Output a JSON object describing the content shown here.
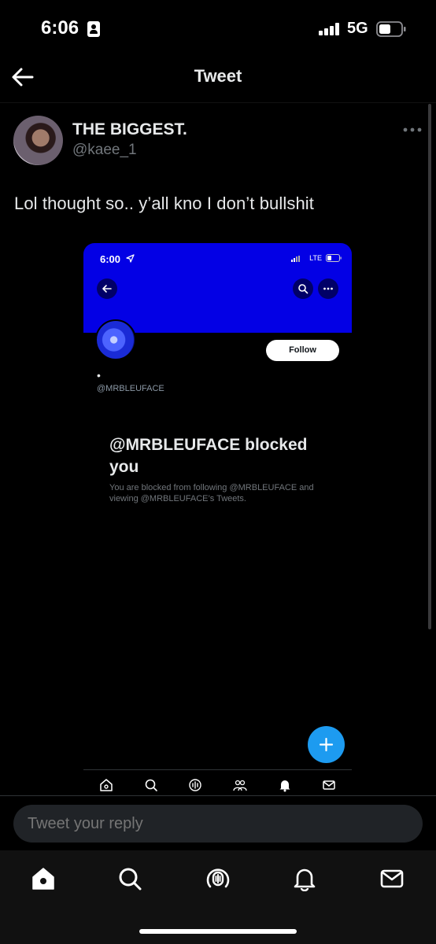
{
  "status_bar": {
    "time": "6:06",
    "network": "5G"
  },
  "header": {
    "title": "Tweet"
  },
  "tweet": {
    "author_name": "THE BIGGEST.",
    "author_handle": "@kaee_1",
    "text": "Lol thought so.. y’all kno I don’t bullshit"
  },
  "embedded_screenshot": {
    "status_time": "6:00",
    "status_network": "LTE",
    "follow_label": "Follow",
    "display_name": "•",
    "handle": "@MRBLEUFACE",
    "blocked_title": "@MRBLEUFACE blocked you",
    "blocked_description": "You are blocked from following @MRBLEUFACE and viewing @MRBLEUFACE’s Tweets.",
    "header_color": "#0300e5",
    "fab_color": "#1d9bf0"
  },
  "reply": {
    "placeholder": "Tweet your reply"
  },
  "tab_bar": {
    "items": [
      "home-icon",
      "search-icon",
      "spaces-icon",
      "notifications-icon",
      "messages-icon"
    ]
  }
}
